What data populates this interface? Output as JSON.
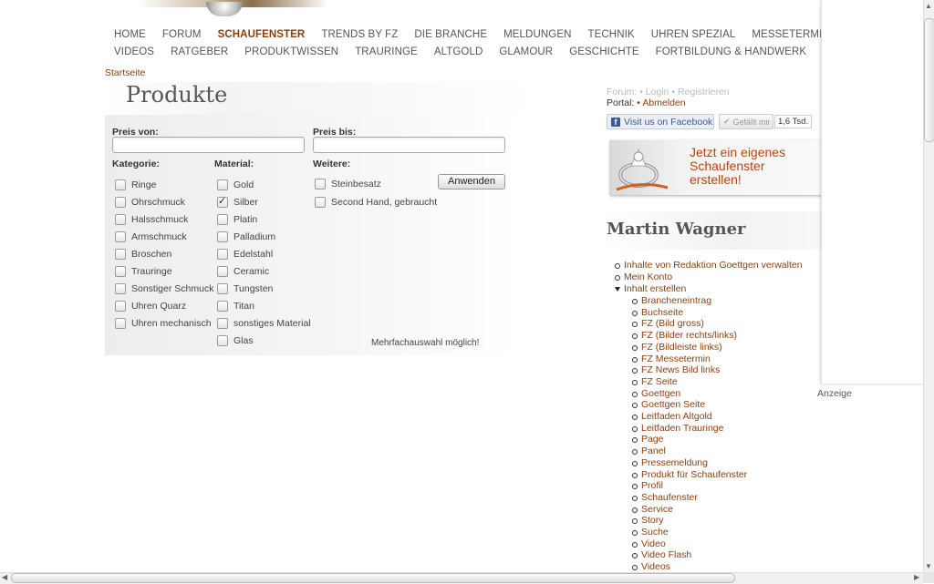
{
  "nav": {
    "row1": [
      "HOME",
      "FORUM",
      "SCHAUFENSTER",
      "TRENDS BY FZ",
      "DIE BRANCHE",
      "MELDUNGEN",
      "TECHNIK",
      "UHREN SPEZIAL",
      "MESSETERMINE"
    ],
    "row2": [
      "VIDEOS",
      "RATGEBER",
      "PRODUKTWISSEN",
      "TRAURINGE",
      "ALTGOLD",
      "GLAMOUR",
      "GESCHICHTE",
      "FORTBILDUNG & HANDWERK"
    ],
    "active": "SCHAUFENSTER"
  },
  "breadcrumb": "Startseite",
  "page_title": "Produkte",
  "filter": {
    "price_from_label": "Preis von:",
    "price_to_label": "Preis bis:",
    "price_from_value": "",
    "price_to_value": "",
    "kategorie_label": "Kategorie:",
    "material_label": "Material:",
    "weitere_label": "Weitere:",
    "kategorie": [
      "Ringe",
      "Ohrschmuck",
      "Halsschmuck",
      "Armschmuck",
      "Broschen",
      "Trauringe",
      "Sonstiger Schmuck",
      "Uhren Quarz",
      "Uhren mechanisch"
    ],
    "material": [
      {
        "label": "Gold",
        "checked": false
      },
      {
        "label": "Silber",
        "checked": true
      },
      {
        "label": "Platin",
        "checked": false
      },
      {
        "label": "Palladium",
        "checked": false
      },
      {
        "label": "Edelstahl",
        "checked": false
      },
      {
        "label": "Ceramic",
        "checked": false
      },
      {
        "label": "Tungsten",
        "checked": false
      },
      {
        "label": "Titan",
        "checked": false
      },
      {
        "label": "sonstiges Material",
        "checked": false
      },
      {
        "label": "Glas",
        "checked": false
      }
    ],
    "weitere": [
      "Steinbesatz",
      "Second Hand, gebraucht"
    ],
    "apply_label": "Anwenden",
    "multi_note": "Mehrfachauswahl möglich!"
  },
  "account": {
    "forum": "Forum:",
    "login": "Login",
    "register": "Registrieren",
    "portal": "Portal:",
    "logout": "Abmelden",
    "sep": "•"
  },
  "social": {
    "facebook_label": "Visit us on Facebook",
    "like_label": "Gefällt mir",
    "like_count": "1,6 Tsd."
  },
  "ad": {
    "text_line1": "Jetzt ein eigenes",
    "text_line2": "Schaufenster",
    "text_line3": "erstellen!",
    "accent": "#c0400a"
  },
  "user": {
    "name": "Martin Wagner",
    "menu": [
      "Inhalte von Redaktion Goettgen verwalten",
      "Mein Konto",
      "Inhalt erstellen"
    ],
    "submenu": [
      "Brancheneintrag",
      "Buchseite",
      "FZ (Bild gross)",
      "FZ (Bilder rechts/links)",
      "FZ (Bildleiste links)",
      "FZ Messetermin",
      "FZ News Bild links",
      "FZ Seite",
      "Goettgen",
      "Goettgen Seite",
      "Leitfaden Altgold",
      "Leitfaden Trauringe",
      "Page",
      "Panel",
      "Pressemeldung",
      "Produkt für Schaufenster",
      "Profil",
      "Schaufenster",
      "Service",
      "Story",
      "Suche",
      "Video",
      "Video Flash",
      "Videos"
    ]
  },
  "sidebar_ad_label": "Anzeige",
  "colors": {
    "link": "#8a3f0b",
    "facebook": "#3b5998"
  }
}
